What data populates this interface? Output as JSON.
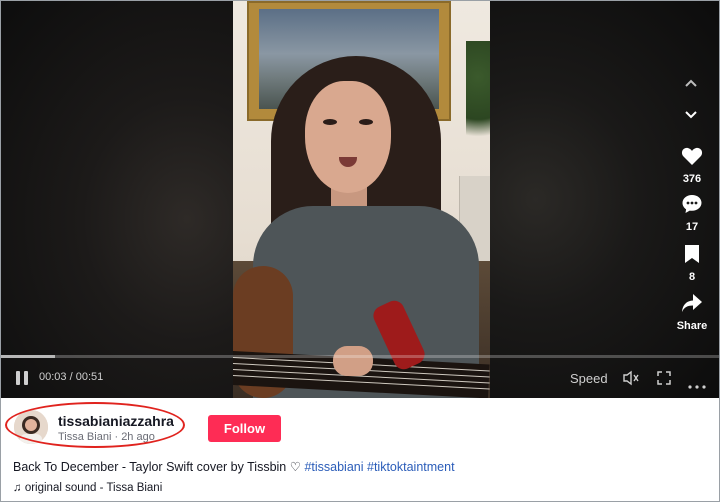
{
  "player": {
    "current_time": "00:03",
    "separator": "/",
    "duration": "00:51",
    "progress_fraction": 0.075,
    "speed_label": "Speed"
  },
  "side_actions": {
    "likes": "376",
    "comments": "17",
    "saves": "8",
    "share_label": "Share"
  },
  "author": {
    "username": "tissabianiazzahra",
    "display_name": "Tissa Biani",
    "dot": "·",
    "posted": "2h ago",
    "follow_label": "Follow"
  },
  "caption": {
    "text": "Back To December - Taylor Swift cover by Tissbin",
    "heart_glyph": "♡",
    "hashtags": [
      "#tissabiani",
      "#tiktoktaintment"
    ]
  },
  "sound": {
    "icon_glyph": "♫",
    "label": "original sound - Tissa Biani"
  },
  "colors": {
    "follow": "#fe2c55",
    "hashtag": "#2b5db9",
    "highlight": "#e0231e"
  }
}
